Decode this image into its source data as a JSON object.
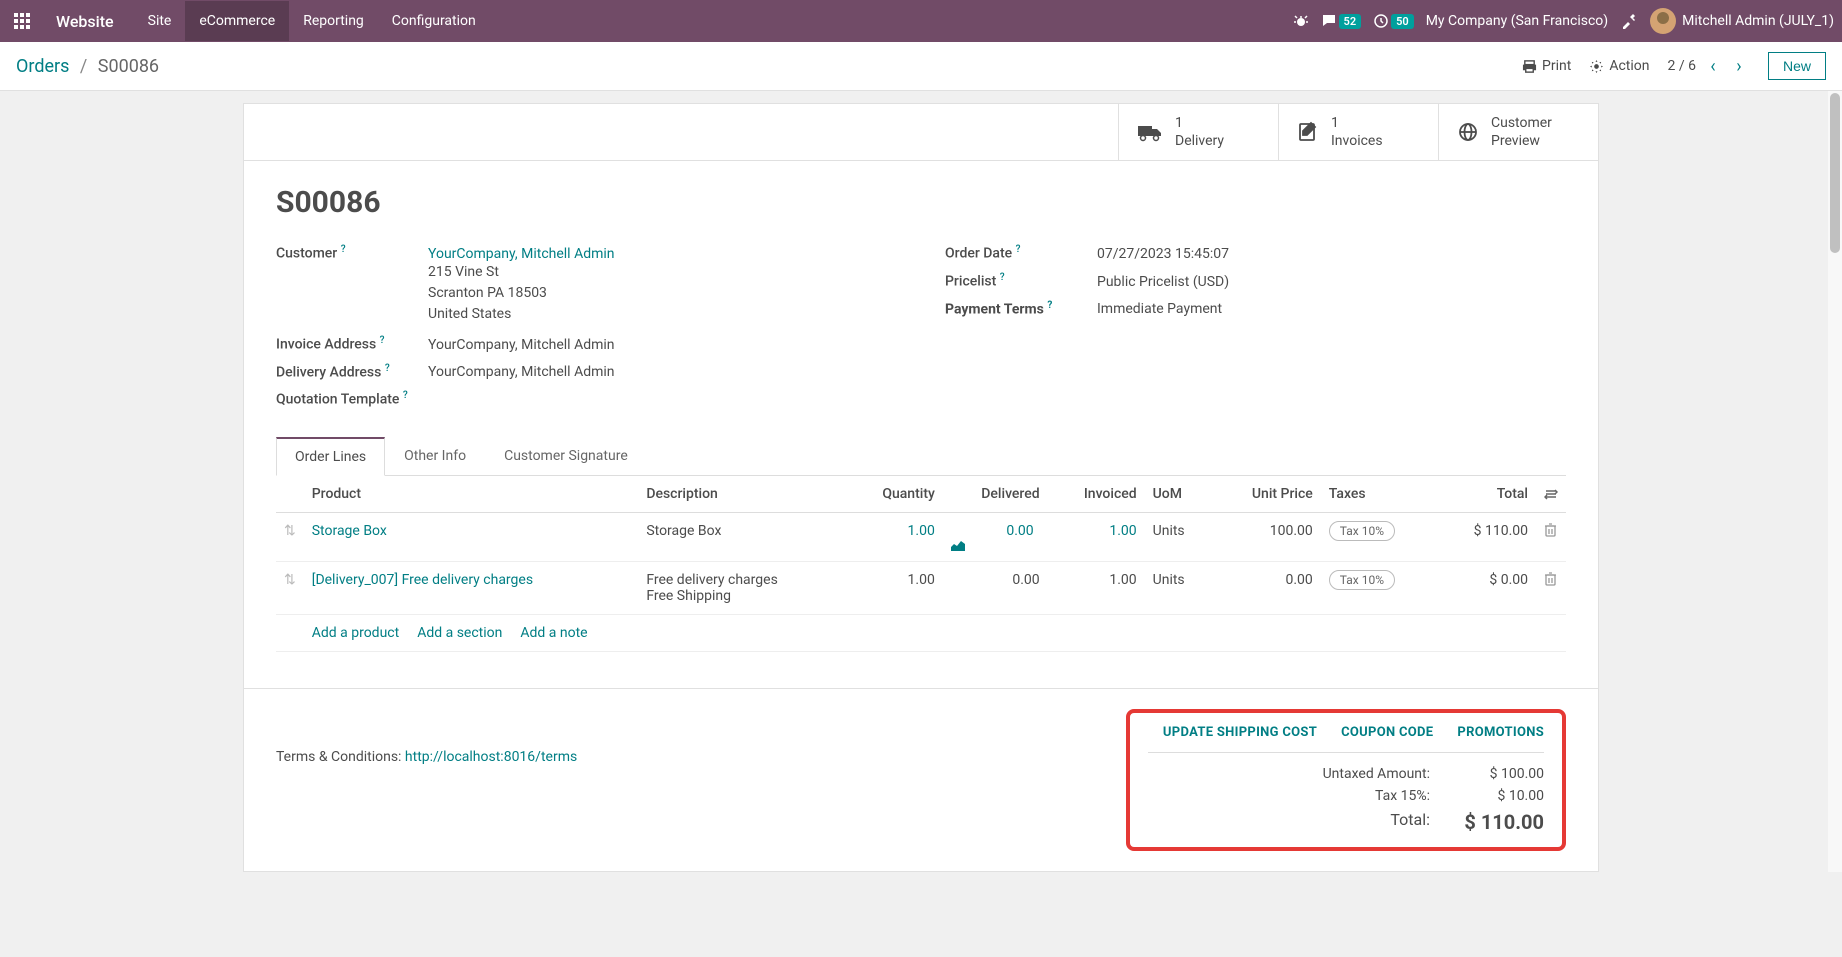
{
  "navbar": {
    "app_title": "Website",
    "menu": [
      "Site",
      "eCommerce",
      "Reporting",
      "Configuration"
    ],
    "active_menu_index": 1,
    "chat_badge": "52",
    "clock_badge": "50",
    "company": "My Company (San Francisco)",
    "user": "Mitchell Admin (JULY_1)"
  },
  "breadcrumbs": {
    "parent": "Orders",
    "current": "S00086"
  },
  "toolbar": {
    "print": "Print",
    "action": "Action",
    "pager": "2 / 6",
    "new": "New"
  },
  "stat_buttons": [
    {
      "count": "1",
      "label": "Delivery",
      "icon": "truck"
    },
    {
      "count": "1",
      "label": "Invoices",
      "icon": "pencil"
    },
    {
      "count": "",
      "label": "Customer",
      "label2": "Preview",
      "icon": "globe"
    }
  ],
  "order": {
    "name": "S00086",
    "customer_label": "Customer",
    "customer_name": "YourCompany, Mitchell Admin",
    "address": [
      "215 Vine St",
      "Scranton PA 18503",
      "United States"
    ],
    "invoice_addr_label": "Invoice Address",
    "invoice_addr": "YourCompany, Mitchell Admin",
    "delivery_addr_label": "Delivery Address",
    "delivery_addr": "YourCompany, Mitchell Admin",
    "quote_tmpl_label": "Quotation Template",
    "quote_tmpl": "",
    "date_label": "Order Date",
    "date": "07/27/2023 15:45:07",
    "pricelist_label": "Pricelist",
    "pricelist": "Public Pricelist (USD)",
    "terms_label": "Payment Terms",
    "terms": "Immediate Payment"
  },
  "tabs": [
    "Order Lines",
    "Other Info",
    "Customer Signature"
  ],
  "active_tab_index": 0,
  "table": {
    "headers": [
      "Product",
      "Description",
      "Quantity",
      "Delivered",
      "Invoiced",
      "UoM",
      "Unit Price",
      "Taxes",
      "Total"
    ],
    "rows": [
      {
        "product": "Storage Box",
        "description": "Storage Box",
        "qty": "1.00",
        "delivered": "0.00",
        "invoiced": "1.00",
        "uom": "Units",
        "unit_price": "100.00",
        "tax": "Tax 10%",
        "total": "$ 110.00",
        "qty_link": true,
        "del_link": true,
        "inv_link": true,
        "chart": true
      },
      {
        "product": "[Delivery_007] Free delivery charges",
        "description": "Free delivery charges\nFree Shipping",
        "qty": "1.00",
        "delivered": "0.00",
        "invoiced": "1.00",
        "uom": "Units",
        "unit_price": "0.00",
        "tax": "Tax 10%",
        "total": "$ 0.00",
        "qty_link": false,
        "del_link": false,
        "inv_link": false,
        "chart": false
      }
    ],
    "add_product": "Add a product",
    "add_section": "Add a section",
    "add_note": "Add a note"
  },
  "footer": {
    "terms_prefix": "Terms & Conditions: ",
    "terms_link": "http://localhost:8016/terms",
    "actions": [
      "UPDATE SHIPPING COST",
      "COUPON CODE",
      "PROMOTIONS"
    ],
    "lines": [
      {
        "label": "Untaxed Amount:",
        "value": "$ 100.00"
      },
      {
        "label": "Tax 15%:",
        "value": "$ 10.00"
      }
    ],
    "total_label": "Total:",
    "total_value": "$ 110.00"
  }
}
